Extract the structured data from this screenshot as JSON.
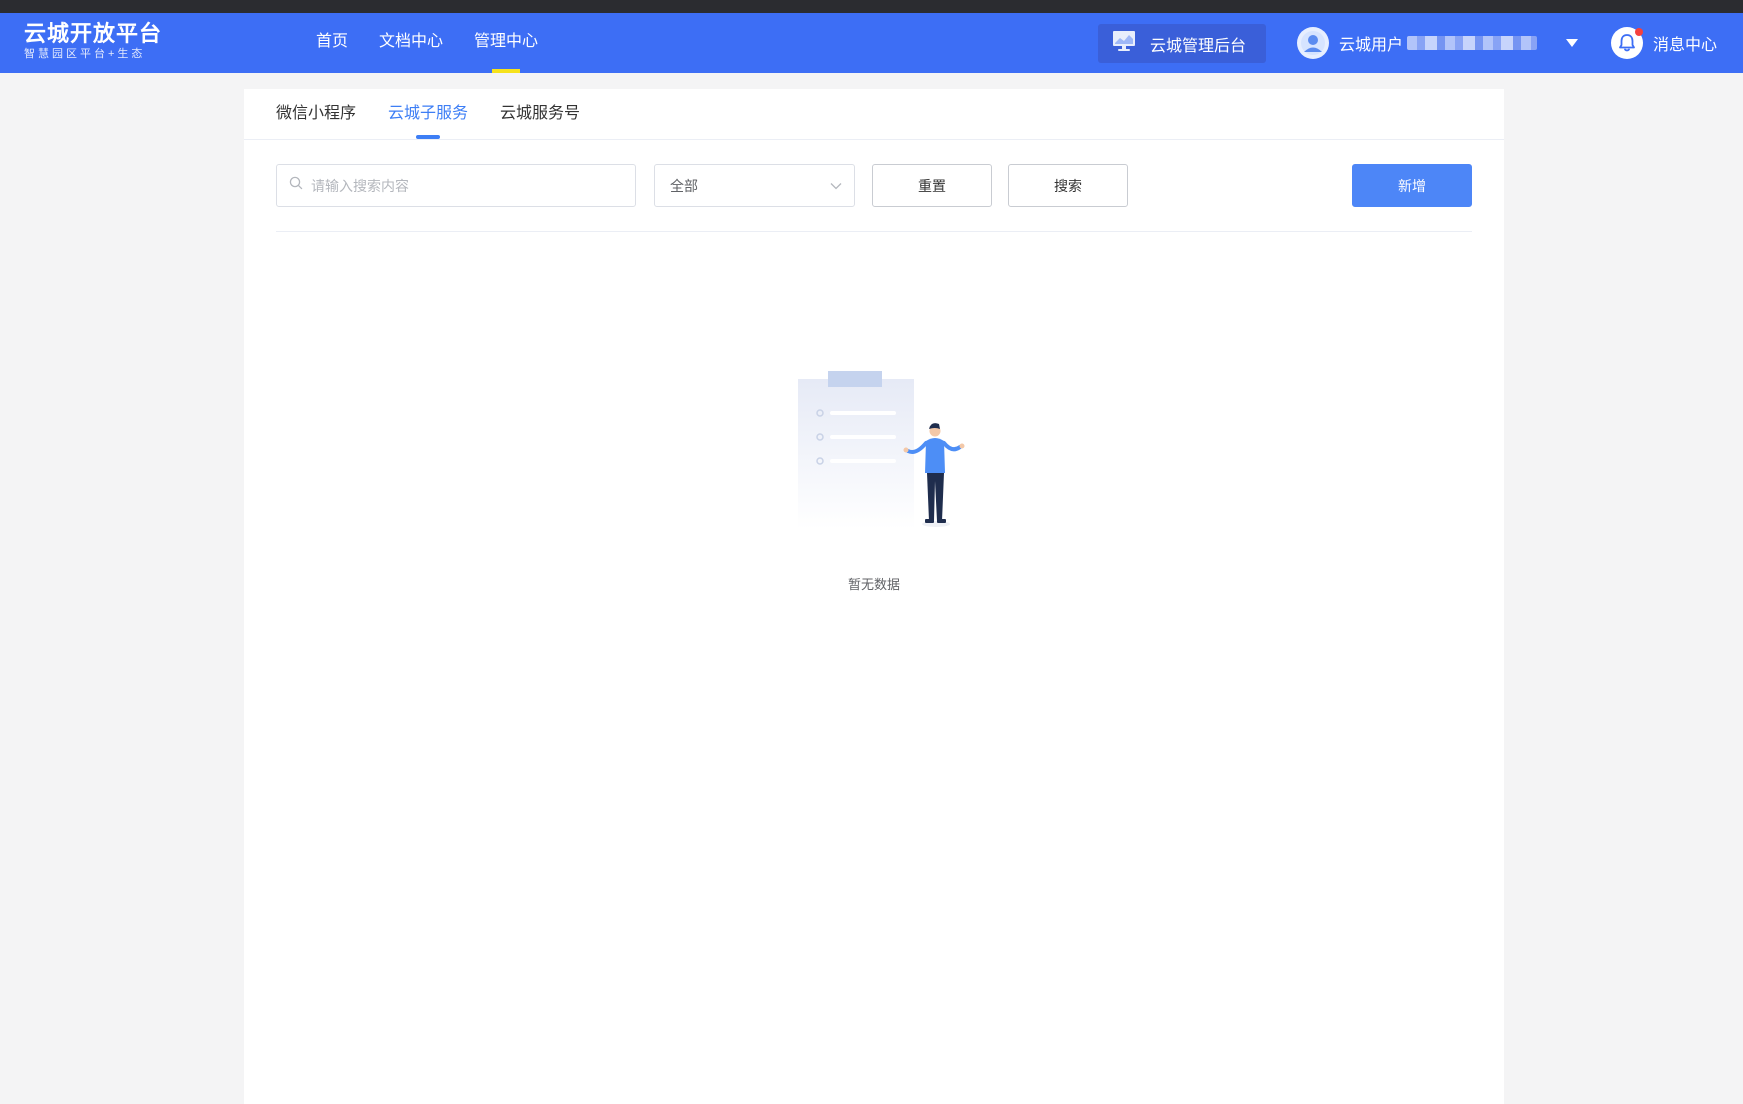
{
  "header": {
    "logo_title": "云城开放平台",
    "logo_subtitle": "智慧园区平台+生态",
    "nav": [
      {
        "label": "首页",
        "active": false
      },
      {
        "label": "文档中心",
        "active": false
      },
      {
        "label": "管理中心",
        "active": true
      }
    ],
    "admin_button_label": "云城管理后台",
    "user_name": "云城用户",
    "message_center_label": "消息中心",
    "has_unread": true
  },
  "tabs": [
    {
      "label": "微信小程序",
      "active": false
    },
    {
      "label": "云城子服务",
      "active": true
    },
    {
      "label": "云城服务号",
      "active": false
    }
  ],
  "filters": {
    "search_placeholder": "请输入搜索内容",
    "search_value": "",
    "select_value": "全部",
    "reset_label": "重置",
    "search_label": "搜索",
    "add_label": "新增"
  },
  "empty_state": {
    "text": "暂无数据"
  },
  "colors": {
    "header_bg": "#3d6ef5",
    "active_nav_indicator": "#f6e21b",
    "accent": "#3d7ef5",
    "primary_button": "#4d86f7",
    "notification_dot": "#f5413e"
  }
}
